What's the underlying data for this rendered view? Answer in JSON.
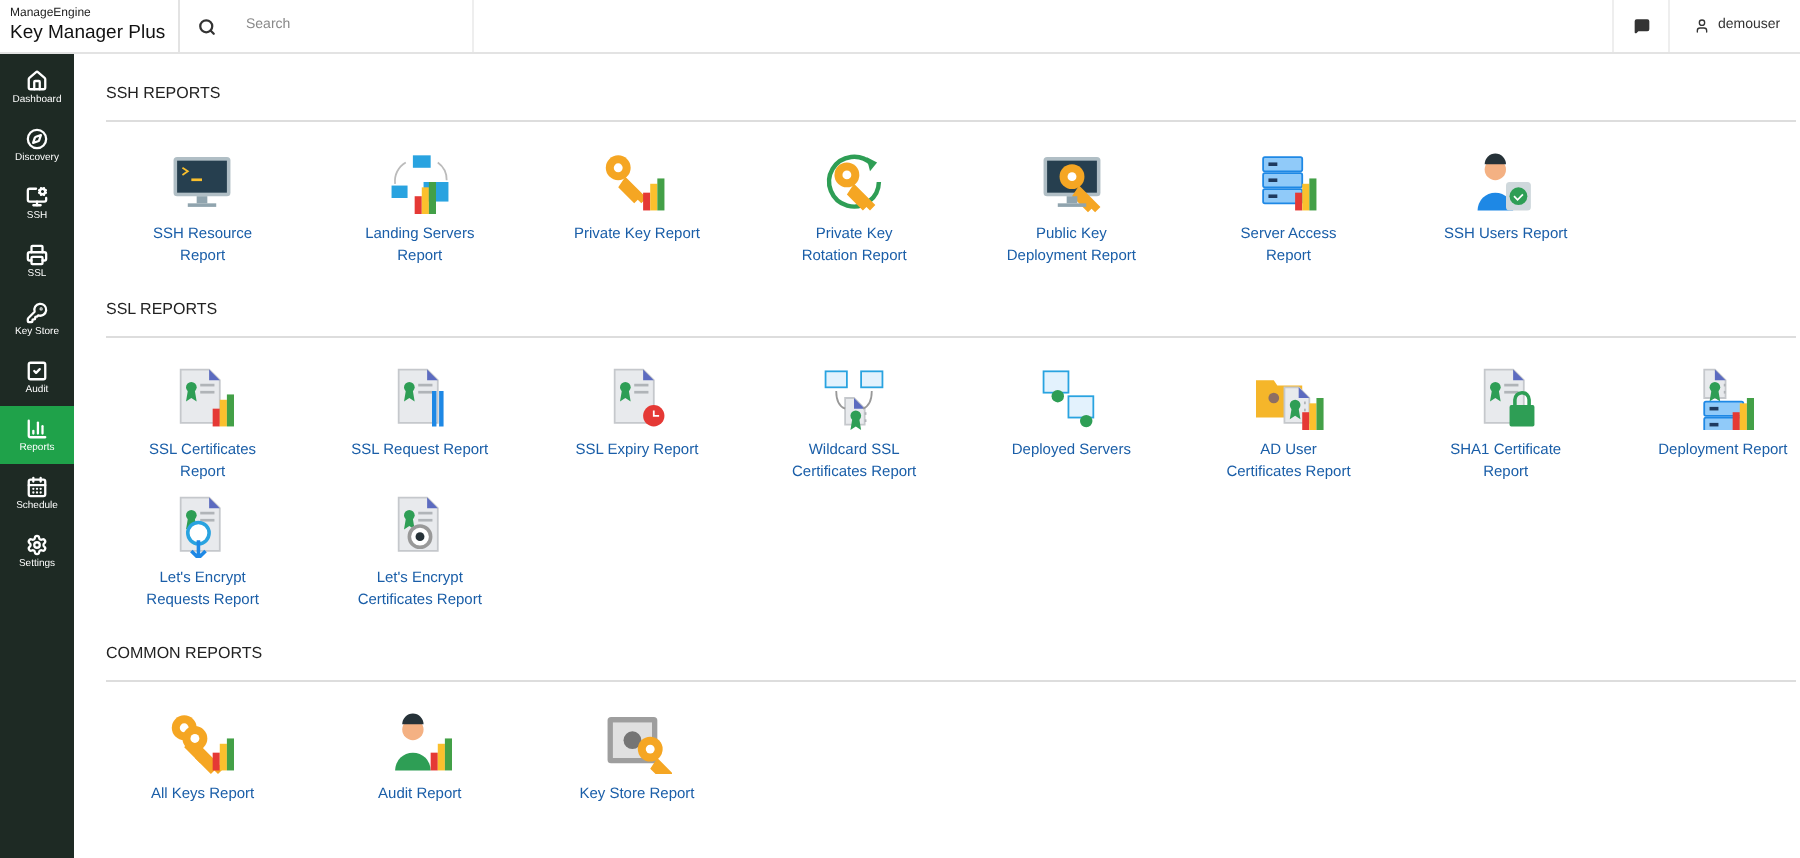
{
  "brand": {
    "company": "ManageEngine",
    "product": "Key Manager Plus"
  },
  "search": {
    "placeholder": "Search"
  },
  "user": {
    "name": "demouser"
  },
  "sidebar": {
    "items": [
      {
        "label": "Dashboard",
        "selected": false
      },
      {
        "label": "Discovery",
        "selected": false
      },
      {
        "label": "SSH",
        "selected": false
      },
      {
        "label": "SSL",
        "selected": false
      },
      {
        "label": "Key Store",
        "selected": false
      },
      {
        "label": "Audit",
        "selected": false
      },
      {
        "label": "Reports",
        "selected": true
      },
      {
        "label": "Schedule",
        "selected": false
      },
      {
        "label": "Settings",
        "selected": false
      }
    ]
  },
  "sections": [
    {
      "title": "SSH REPORTS",
      "reports": [
        "SSH Resource\nReport",
        "Landing Servers\nReport",
        "Private Key Report",
        "Private Key\nRotation Report",
        "Public Key\nDeployment Report",
        "Server Access\nReport",
        "SSH Users Report"
      ]
    },
    {
      "title": "SSL REPORTS",
      "reports": [
        "SSL Certificates\nReport",
        "SSL Request Report",
        "SSL Expiry Report",
        "Wildcard SSL\nCertificates Report",
        "Deployed Servers",
        "AD User\nCertificates Report",
        "SHA1 Certificate\nReport",
        "Deployment Report",
        "Let's Encrypt\nRequests Report",
        "Let's Encrypt\nCertificates Report"
      ]
    },
    {
      "title": "COMMON REPORTS",
      "reports": [
        "All Keys Report",
        "Audit Report",
        "Key Store Report"
      ]
    }
  ]
}
